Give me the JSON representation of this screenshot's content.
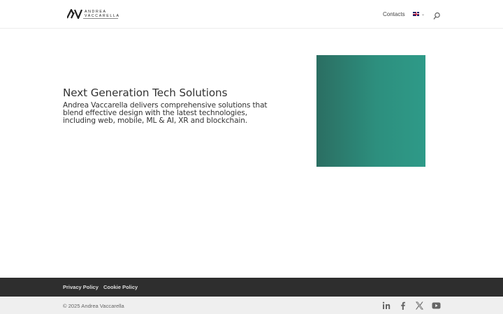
{
  "header": {
    "logo": {
      "line1": "ANDREA",
      "line2": "VACCARELLA"
    },
    "nav": {
      "contacts": "Contacts"
    },
    "language": {
      "flag": "uk-flag-icon",
      "caret": "⌄"
    },
    "search_icon": "search-icon"
  },
  "hero": {
    "title": "Next Generation Tech Solutions",
    "text": "Andrea Vaccarella delivers comprehensive solutions that blend effective design with the latest technologies, including web, mobile, ML & AI, XR and blockchain.",
    "image_colors": {
      "start": "#2b6e62",
      "end": "#2e9a88"
    }
  },
  "footer": {
    "links": [
      "Privacy Policy",
      "Cookie Policy"
    ],
    "copyright": "© 2025 Andrea Vaccarella",
    "social": [
      "linkedin-icon",
      "facebook-icon",
      "x-icon",
      "youtube-icon"
    ],
    "colors": {
      "top_bar": "#2e2e2e",
      "bottom_bar": "#efefef"
    }
  }
}
